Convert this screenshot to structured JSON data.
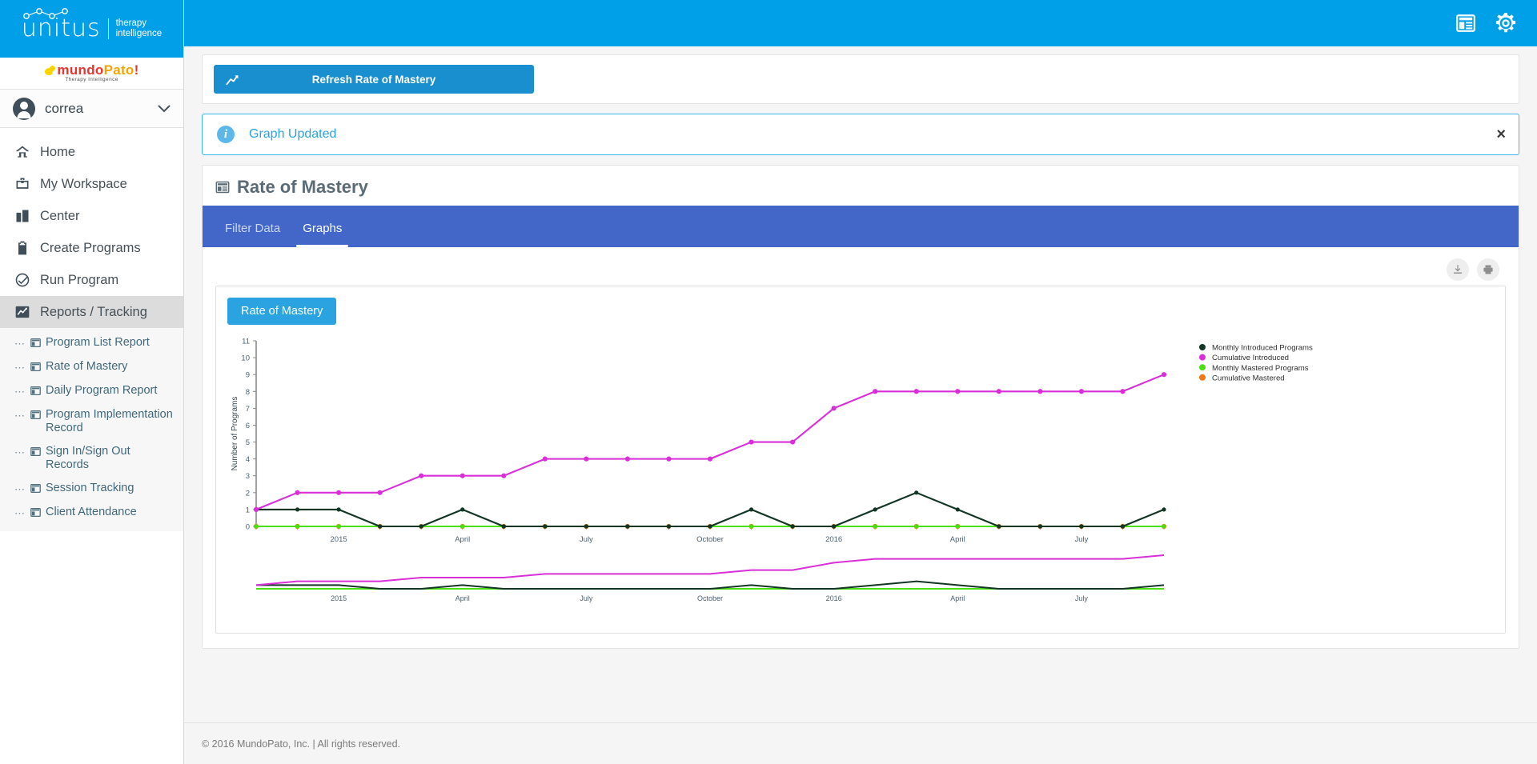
{
  "brand": {
    "logo_word": "unitus",
    "logo_sub_line1": "therapy",
    "logo_sub_line2": "intelligence",
    "product_name_parts": [
      "mundo",
      "Pato",
      "!"
    ],
    "product_tagline": "Therapy Intelligence"
  },
  "user": {
    "name": "correa",
    "chevron": "⌄"
  },
  "sidebar": {
    "items": [
      {
        "label": "Home",
        "icon": "home-icon",
        "active": false
      },
      {
        "label": "My Workspace",
        "icon": "briefcase-icon",
        "active": false
      },
      {
        "label": "Center",
        "icon": "building-icon",
        "active": false
      },
      {
        "label": "Create Programs",
        "icon": "clipboard-icon",
        "active": false
      },
      {
        "label": "Run Program",
        "icon": "check-circle-icon",
        "active": false
      },
      {
        "label": "Reports / Tracking",
        "icon": "chart-line-icon",
        "active": true
      }
    ],
    "subitems": [
      {
        "label": "Program List Report",
        "icon": "report-icon"
      },
      {
        "label": "Rate of Mastery",
        "icon": "report-icon"
      },
      {
        "label": "Daily Program Report",
        "icon": "report-icon"
      },
      {
        "label": "Program Implementation Record",
        "icon": "report-icon"
      },
      {
        "label": "Sign In/Sign Out Records",
        "icon": "report-icon"
      },
      {
        "label": "Session Tracking",
        "icon": "report-icon"
      },
      {
        "label": "Client Attendance",
        "icon": "report-icon"
      }
    ]
  },
  "topbar": {
    "icons": [
      {
        "name": "reports-icon"
      },
      {
        "name": "gear-icon"
      }
    ],
    "background": "#00a0e9"
  },
  "refresh": {
    "label": "Refresh Rate of Mastery",
    "icon": "chart-line-icon",
    "background": "#1a8fd0"
  },
  "alert": {
    "icon": "info-icon",
    "message": "Graph Updated",
    "close_label": "×",
    "border_color": "#3fb5e8",
    "text_color": "#2aa3e0"
  },
  "panel": {
    "icon": "report-icon",
    "title": "Rate of Mastery",
    "tabs": [
      {
        "label": "Filter Data",
        "active": false
      },
      {
        "label": "Graphs",
        "active": true
      }
    ],
    "tab_background": "#4267c8"
  },
  "graph_toolbar": {
    "buttons": [
      {
        "name": "download-icon",
        "label": "Download"
      },
      {
        "name": "print-icon",
        "label": "Print"
      }
    ]
  },
  "chart_button": {
    "label": "Rate of Mastery",
    "background": "#2aa3e0"
  },
  "chart_data": {
    "type": "line",
    "title": "Rate of Mastery",
    "xlabel": "",
    "ylabel": "Number of Programs",
    "ylim": [
      0,
      11
    ],
    "yticks": [
      0,
      1,
      2,
      3,
      4,
      5,
      6,
      7,
      8,
      9,
      10,
      11
    ],
    "grid": false,
    "legend_position": "top-right",
    "x_tick_labels": [
      "2015",
      "April",
      "July",
      "October",
      "2016",
      "April",
      "July"
    ],
    "x_tick_indices": [
      2,
      5,
      8,
      11,
      14,
      17,
      20
    ],
    "x": [
      0,
      1,
      2,
      3,
      4,
      5,
      6,
      7,
      8,
      9,
      10,
      11,
      12,
      13,
      14,
      15,
      16,
      17,
      18,
      19,
      20,
      21,
      22
    ],
    "series": [
      {
        "name": "Monthly Introduced Programs",
        "color": "#123524",
        "values": [
          1,
          1,
          1,
          0,
          0,
          1,
          0,
          0,
          0,
          0,
          0,
          0,
          1,
          0,
          0,
          1,
          2,
          1,
          0,
          0,
          0,
          0,
          1
        ]
      },
      {
        "name": "Cumulative Introduced",
        "color": "#d82fd8",
        "values": [
          1,
          2,
          2,
          2,
          3,
          3,
          3,
          4,
          4,
          4,
          4,
          4,
          5,
          5,
          7,
          8,
          8,
          8,
          8,
          8,
          8,
          8,
          9
        ]
      },
      {
        "name": "Monthly Mastered Programs",
        "color": "#4ae010",
        "values": [
          0,
          0,
          0,
          0,
          0,
          0,
          0,
          0,
          0,
          0,
          0,
          0,
          0,
          0,
          0,
          0,
          0,
          0,
          0,
          0,
          0,
          0,
          0
        ]
      },
      {
        "name": "Cumulative Mastered",
        "color": "#f07818",
        "values": [
          0,
          0,
          0,
          0,
          0,
          0,
          0,
          0,
          0,
          0,
          0,
          0,
          0,
          0,
          0,
          0,
          0,
          0,
          0,
          0,
          0,
          0,
          0
        ]
      }
    ],
    "navigator": {
      "x_tick_labels": [
        "2015",
        "April",
        "July",
        "October",
        "2016",
        "April",
        "July"
      ],
      "visible": true
    }
  },
  "footer": {
    "text": "© 2016 MundoPato, Inc. | All rights reserved."
  }
}
